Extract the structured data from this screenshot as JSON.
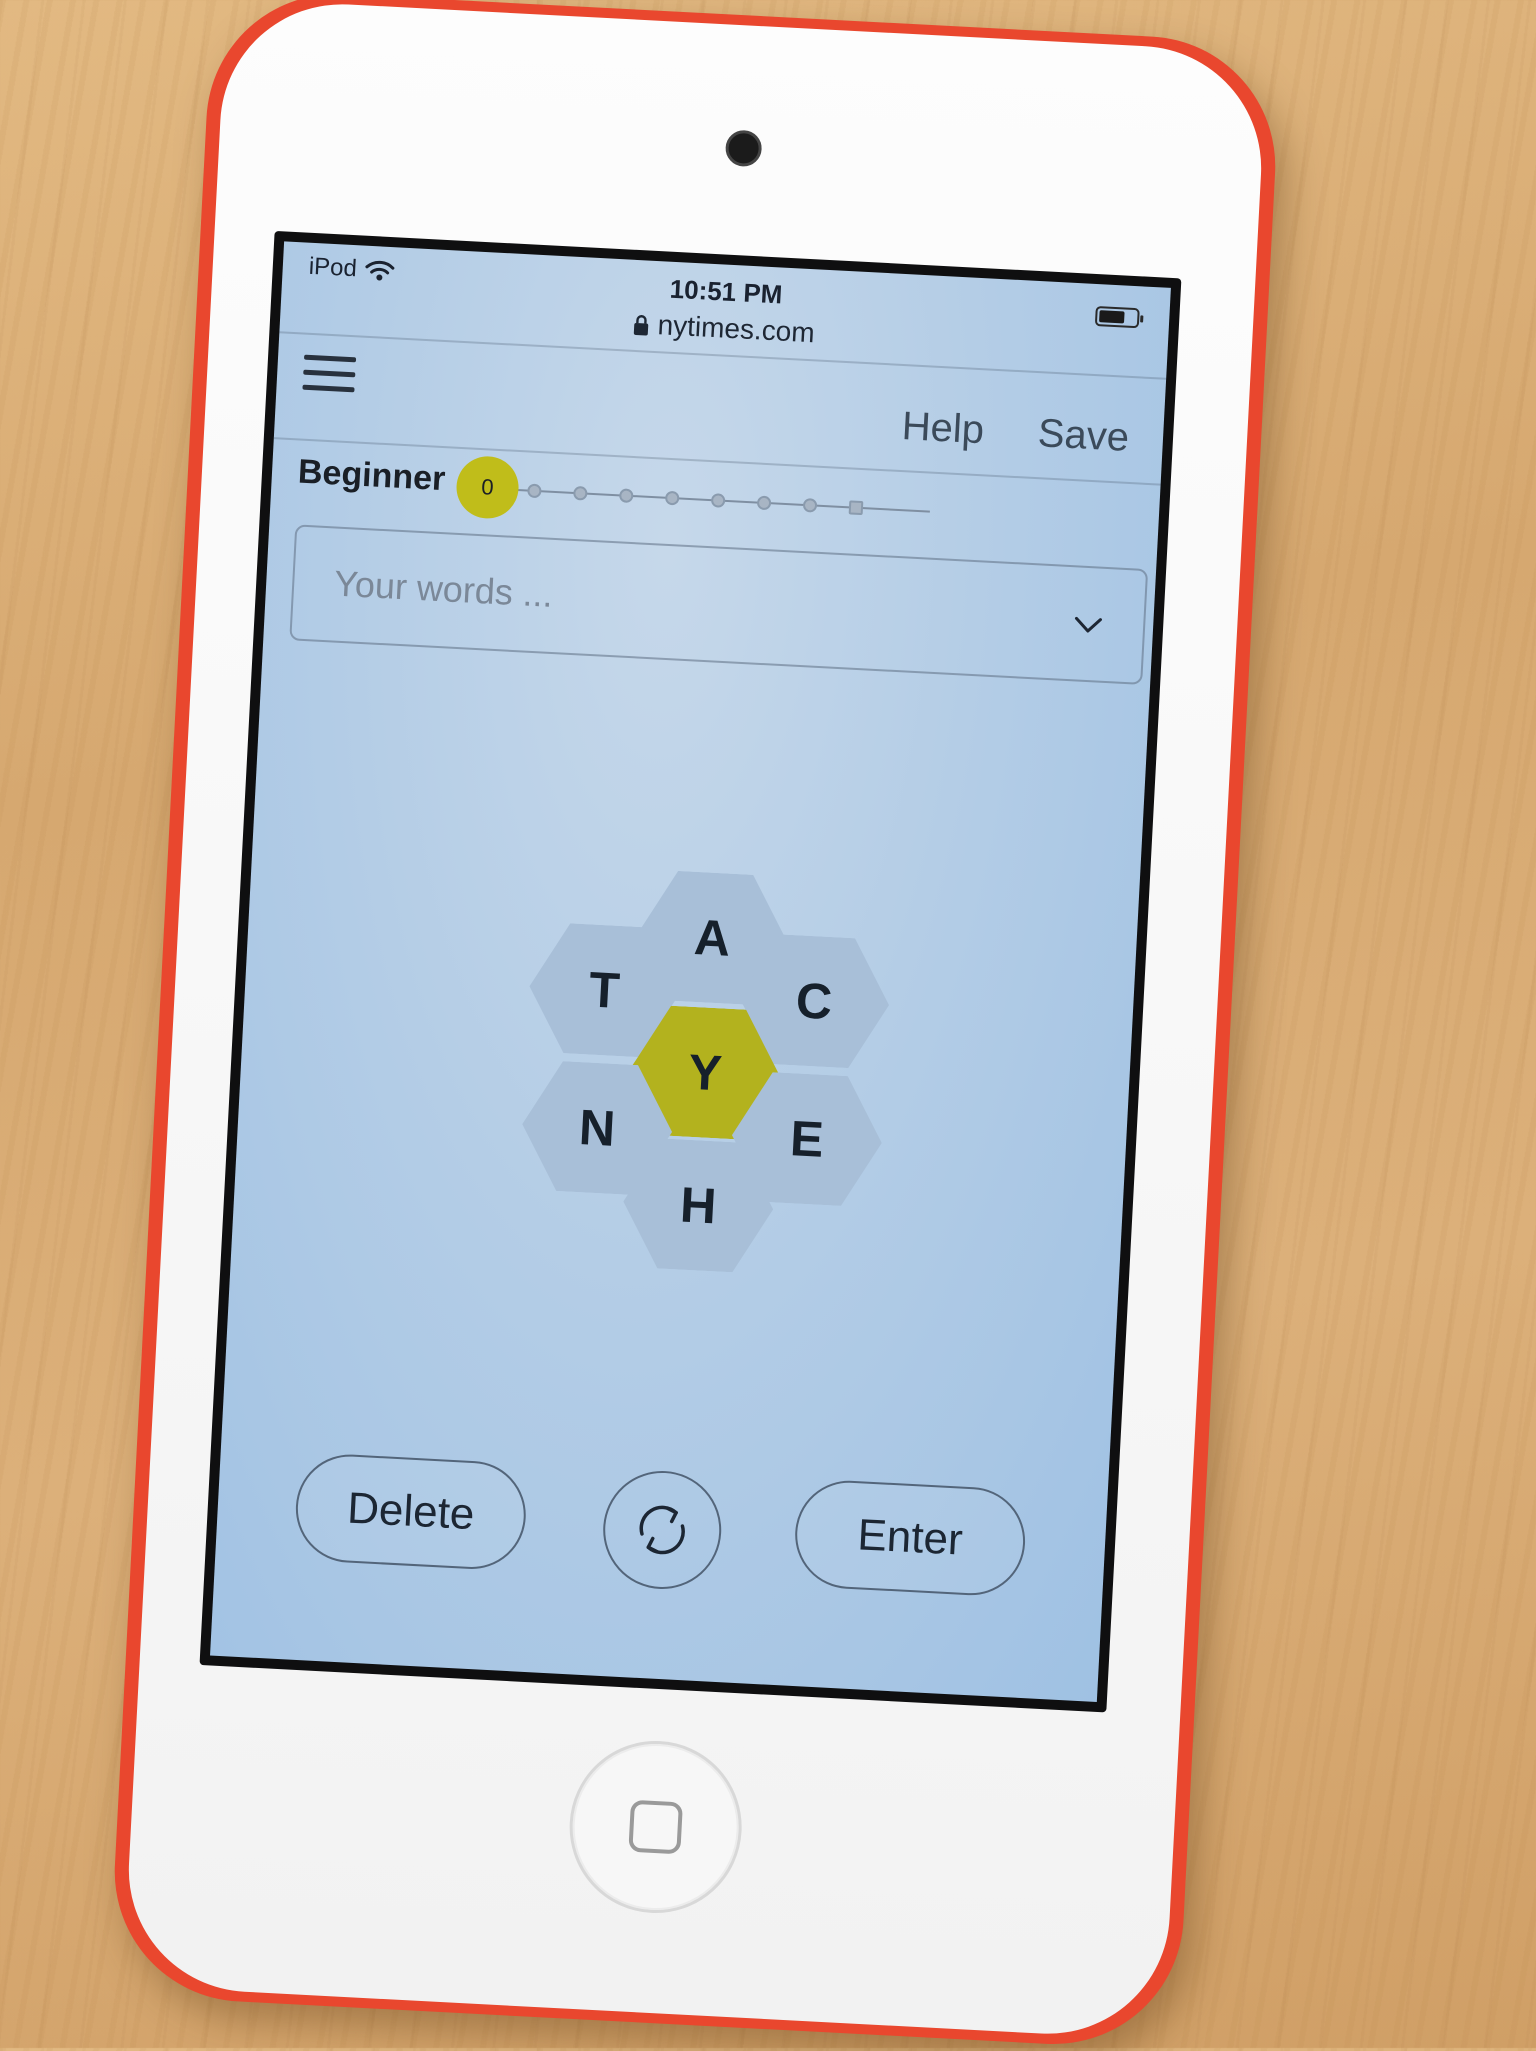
{
  "status_bar": {
    "device": "iPod",
    "time": "10:51 PM",
    "url": "nytimes.com",
    "battery_level": 0.7
  },
  "header": {
    "help_label": "Help",
    "save_label": "Save"
  },
  "progress": {
    "rank": "Beginner",
    "score": "0",
    "level_index": 0,
    "level_count": 9
  },
  "words": {
    "placeholder": "Your words ..."
  },
  "hive": {
    "center_letter": "Y",
    "outer_letters": [
      "A",
      "C",
      "E",
      "H",
      "N",
      "T"
    ]
  },
  "controls": {
    "delete_label": "Delete",
    "enter_label": "Enter"
  },
  "colors": {
    "accent_yellow": "#b3b21e",
    "hex_outer": "#a8bfd8",
    "device_red": "#e9472e"
  },
  "icons": {
    "menu": "hamburger-menu-icon",
    "shuffle": "shuffle-icon",
    "lock": "lock-icon",
    "wifi": "wifi-icon",
    "battery": "battery-icon",
    "chevron": "chevron-down-icon",
    "home": "home-button-square"
  }
}
